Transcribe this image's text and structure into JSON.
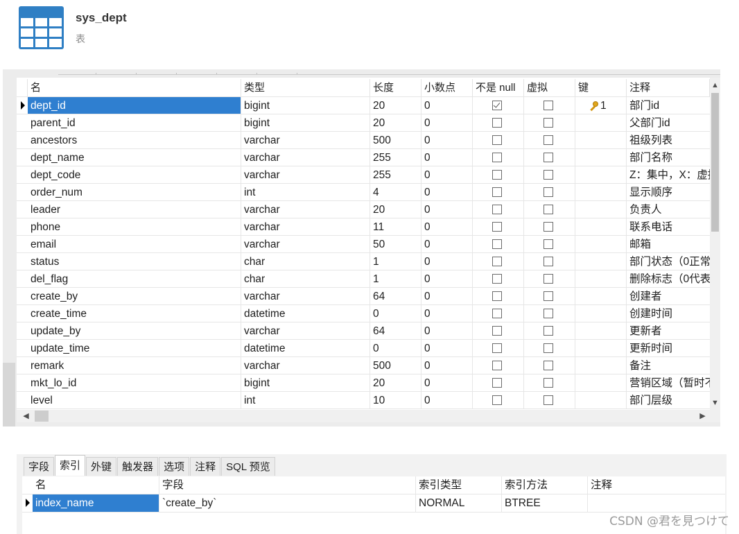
{
  "object": {
    "name": "sys_dept",
    "type_label": "表"
  },
  "fields_grid": {
    "columns": [
      "名",
      "类型",
      "长度",
      "小数点",
      "不是 null",
      "虚拟",
      "键",
      "注释"
    ],
    "rows": [
      {
        "name": "dept_id",
        "type": "bigint",
        "length": "20",
        "decimals": "0",
        "not_null": true,
        "virtual": false,
        "key": "1",
        "comment": "部门id",
        "selected": true
      },
      {
        "name": "parent_id",
        "type": "bigint",
        "length": "20",
        "decimals": "0",
        "not_null": false,
        "virtual": false,
        "key": "",
        "comment": "父部门id"
      },
      {
        "name": "ancestors",
        "type": "varchar",
        "length": "500",
        "decimals": "0",
        "not_null": false,
        "virtual": false,
        "key": "",
        "comment": "祖级列表"
      },
      {
        "name": "dept_name",
        "type": "varchar",
        "length": "255",
        "decimals": "0",
        "not_null": false,
        "virtual": false,
        "key": "",
        "comment": "部门名称"
      },
      {
        "name": "dept_code",
        "type": "varchar",
        "length": "255",
        "decimals": "0",
        "not_null": false,
        "virtual": false,
        "key": "",
        "comment": "Z：集中，X：虚拟"
      },
      {
        "name": "order_num",
        "type": "int",
        "length": "4",
        "decimals": "0",
        "not_null": false,
        "virtual": false,
        "key": "",
        "comment": "显示顺序"
      },
      {
        "name": "leader",
        "type": "varchar",
        "length": "20",
        "decimals": "0",
        "not_null": false,
        "virtual": false,
        "key": "",
        "comment": "负责人"
      },
      {
        "name": "phone",
        "type": "varchar",
        "length": "11",
        "decimals": "0",
        "not_null": false,
        "virtual": false,
        "key": "",
        "comment": "联系电话"
      },
      {
        "name": "email",
        "type": "varchar",
        "length": "50",
        "decimals": "0",
        "not_null": false,
        "virtual": false,
        "key": "",
        "comment": "邮箱"
      },
      {
        "name": "status",
        "type": "char",
        "length": "1",
        "decimals": "0",
        "not_null": false,
        "virtual": false,
        "key": "",
        "comment": "部门状态（0正常"
      },
      {
        "name": "del_flag",
        "type": "char",
        "length": "1",
        "decimals": "0",
        "not_null": false,
        "virtual": false,
        "key": "",
        "comment": "删除标志（0代表"
      },
      {
        "name": "create_by",
        "type": "varchar",
        "length": "64",
        "decimals": "0",
        "not_null": false,
        "virtual": false,
        "key": "",
        "comment": "创建者"
      },
      {
        "name": "create_time",
        "type": "datetime",
        "length": "0",
        "decimals": "0",
        "not_null": false,
        "virtual": false,
        "key": "",
        "comment": "创建时间"
      },
      {
        "name": "update_by",
        "type": "varchar",
        "length": "64",
        "decimals": "0",
        "not_null": false,
        "virtual": false,
        "key": "",
        "comment": "更新者"
      },
      {
        "name": "update_time",
        "type": "datetime",
        "length": "0",
        "decimals": "0",
        "not_null": false,
        "virtual": false,
        "key": "",
        "comment": "更新时间"
      },
      {
        "name": "remark",
        "type": "varchar",
        "length": "500",
        "decimals": "0",
        "not_null": false,
        "virtual": false,
        "key": "",
        "comment": "备注"
      },
      {
        "name": "mkt_lo_id",
        "type": "bigint",
        "length": "20",
        "decimals": "0",
        "not_null": false,
        "virtual": false,
        "key": "",
        "comment": "营销区域（暂时不"
      },
      {
        "name": "level",
        "type": "int",
        "length": "10",
        "decimals": "0",
        "not_null": false,
        "virtual": false,
        "key": "",
        "comment": "部门层级"
      }
    ]
  },
  "icons": {
    "table": "table-icon",
    "key": "key-icon",
    "row_pointer": "row-pointer-icon",
    "scroll_up": "▲",
    "scroll_down": "▼",
    "scroll_left": "◀",
    "scroll_right": "▶"
  },
  "lower_tabs": [
    "字段",
    "索引",
    "外键",
    "触发器",
    "选项",
    "注释",
    "SQL 预览"
  ],
  "lower_active_tab": "索引",
  "index_grid": {
    "columns": [
      "名",
      "字段",
      "索引类型",
      "索引方法",
      "注释"
    ],
    "rows": [
      {
        "name": "index_name",
        "fields": "`create_by`",
        "index_type": "NORMAL",
        "index_method": "BTREE",
        "comment": ""
      }
    ]
  },
  "watermark": "CSDN @君を見つけて",
  "colors": {
    "selection": "#2f7fd0",
    "table_icon": "#2f7fc4"
  }
}
